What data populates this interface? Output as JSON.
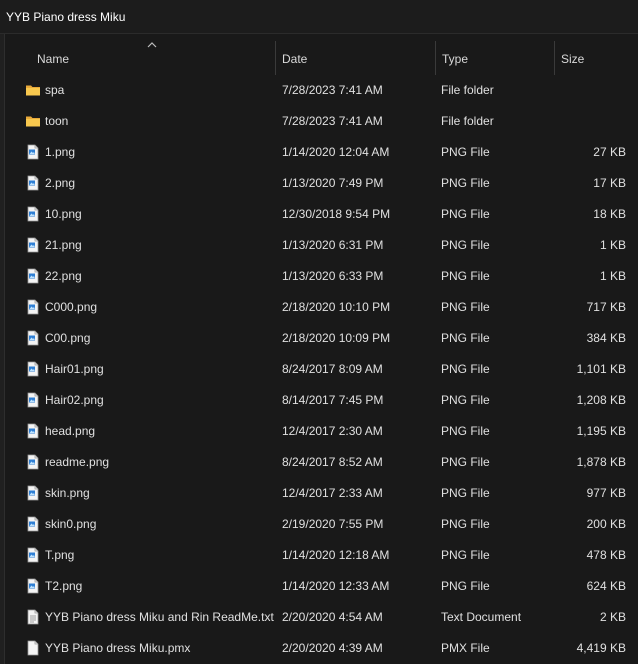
{
  "window": {
    "title": "YYB Piano dress Miku"
  },
  "header": {
    "name": "Name",
    "date": "Date",
    "type": "Type",
    "size": "Size"
  },
  "files": [
    {
      "name": "spa",
      "date": "7/28/2023 7:41 AM",
      "type": "File folder",
      "size": "",
      "icon": "folder-icon"
    },
    {
      "name": "toon",
      "date": "7/28/2023 7:41 AM",
      "type": "File folder",
      "size": "",
      "icon": "folder-icon"
    },
    {
      "name": "1.png",
      "date": "1/14/2020 12:04 AM",
      "type": "PNG File",
      "size": "27 KB",
      "icon": "image-file-icon"
    },
    {
      "name": "2.png",
      "date": "1/13/2020 7:49 PM",
      "type": "PNG File",
      "size": "17 KB",
      "icon": "image-file-icon"
    },
    {
      "name": "10.png",
      "date": "12/30/2018 9:54 PM",
      "type": "PNG File",
      "size": "18 KB",
      "icon": "image-file-icon"
    },
    {
      "name": "21.png",
      "date": "1/13/2020 6:31 PM",
      "type": "PNG File",
      "size": "1 KB",
      "icon": "image-file-icon"
    },
    {
      "name": "22.png",
      "date": "1/13/2020 6:33 PM",
      "type": "PNG File",
      "size": "1 KB",
      "icon": "image-file-icon"
    },
    {
      "name": "C000.png",
      "date": "2/18/2020 10:10 PM",
      "type": "PNG File",
      "size": "717 KB",
      "icon": "image-file-icon"
    },
    {
      "name": "C00.png",
      "date": "2/18/2020 10:09 PM",
      "type": "PNG File",
      "size": "384 KB",
      "icon": "image-file-icon"
    },
    {
      "name": "Hair01.png",
      "date": "8/24/2017 8:09 AM",
      "type": "PNG File",
      "size": "1,101 KB",
      "icon": "image-file-icon"
    },
    {
      "name": "Hair02.png",
      "date": "8/14/2017 7:45 PM",
      "type": "PNG File",
      "size": "1,208 KB",
      "icon": "image-file-icon"
    },
    {
      "name": "head.png",
      "date": "12/4/2017 2:30 AM",
      "type": "PNG File",
      "size": "1,195 KB",
      "icon": "image-file-icon"
    },
    {
      "name": "readme.png",
      "date": "8/24/2017 8:52 AM",
      "type": "PNG File",
      "size": "1,878 KB",
      "icon": "image-file-icon"
    },
    {
      "name": "skin.png",
      "date": "12/4/2017 2:33 AM",
      "type": "PNG File",
      "size": "977 KB",
      "icon": "image-file-icon"
    },
    {
      "name": "skin0.png",
      "date": "2/19/2020 7:55 PM",
      "type": "PNG File",
      "size": "200 KB",
      "icon": "image-file-icon"
    },
    {
      "name": "T.png",
      "date": "1/14/2020 12:18 AM",
      "type": "PNG File",
      "size": "478 KB",
      "icon": "image-file-icon"
    },
    {
      "name": "T2.png",
      "date": "1/14/2020 12:33 AM",
      "type": "PNG File",
      "size": "624 KB",
      "icon": "image-file-icon"
    },
    {
      "name": "YYB Piano dress Miku and Rin ReadMe.txt",
      "date": "2/20/2020 4:54 AM",
      "type": "Text Document",
      "size": "2 KB",
      "icon": "text-file-icon"
    },
    {
      "name": "YYB Piano dress Miku.pmx",
      "date": "2/20/2020 4:39 AM",
      "type": "PMX File",
      "size": "4,419 KB",
      "icon": "generic-file-icon"
    }
  ]
}
